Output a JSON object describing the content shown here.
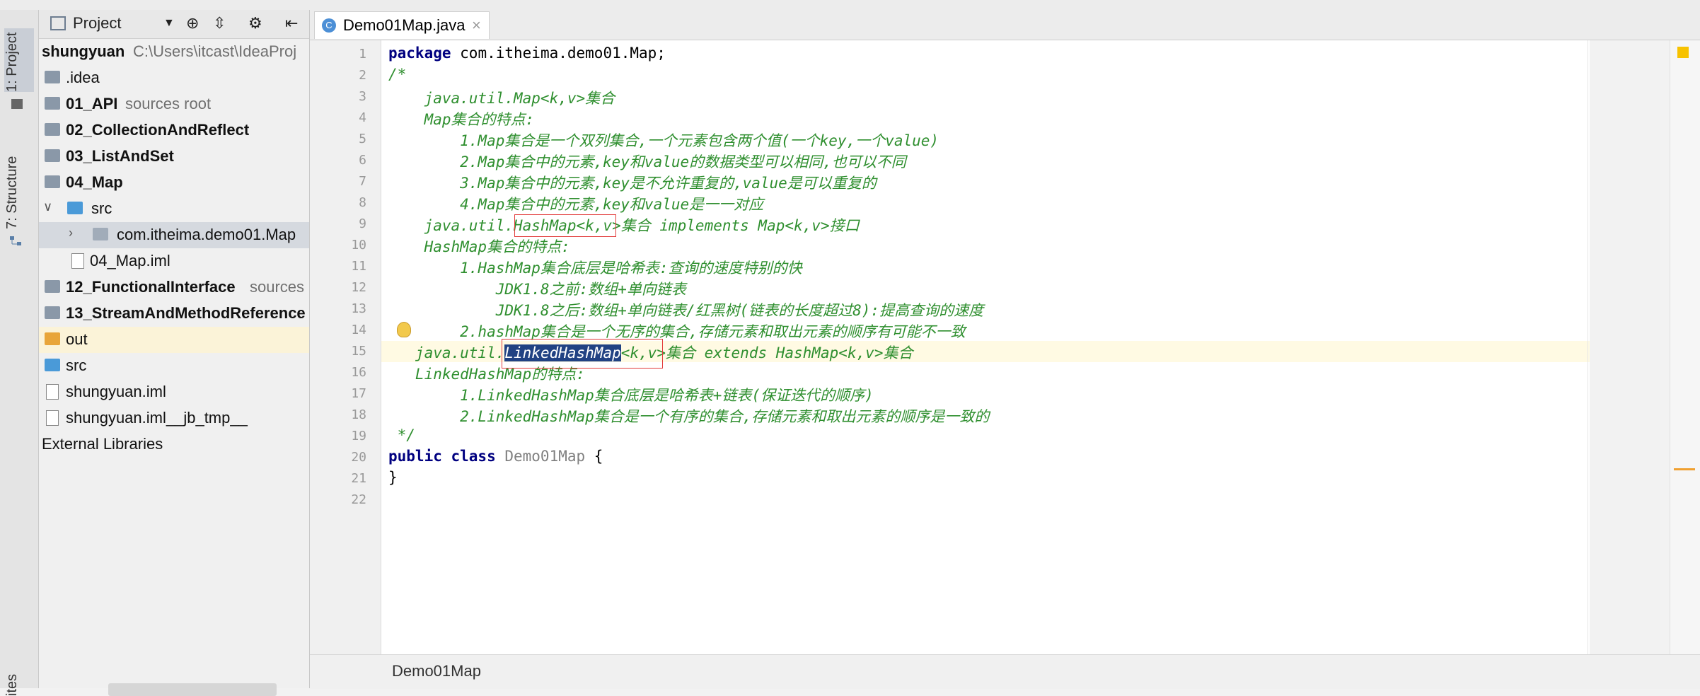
{
  "left_strip": {
    "project_tab": "1: Project",
    "structure_tab": "7: Structure",
    "bottom_tab": "ites"
  },
  "project_panel": {
    "title": "Project",
    "tree": [
      {
        "label": "shungyuan",
        "hint": "C:\\Users\\itcast\\IdeaProj"
      },
      {
        "label": ".idea",
        "hint": ""
      },
      {
        "label": "01_API",
        "hint": "sources root"
      },
      {
        "label": "02_CollectionAndReflect",
        "hint": ""
      },
      {
        "label": "03_ListAndSet",
        "hint": ""
      },
      {
        "label": "04_Map",
        "hint": ""
      },
      {
        "label": "src",
        "hint": ""
      },
      {
        "label": "com.itheima.demo01.Map",
        "hint": ""
      },
      {
        "label": "04_Map.iml",
        "hint": ""
      },
      {
        "label": "12_FunctionalInterface",
        "hint": "sources"
      },
      {
        "label": "13_StreamAndMethodReference",
        "hint": ""
      },
      {
        "label": "out",
        "hint": ""
      },
      {
        "label": "src",
        "hint": ""
      },
      {
        "label": "shungyuan.iml",
        "hint": ""
      },
      {
        "label": "shungyuan.iml__jb_tmp__",
        "hint": ""
      },
      {
        "label": "External Libraries",
        "hint": ""
      }
    ]
  },
  "editor": {
    "tab_label": "Demo01Map.java",
    "line_numbers": [
      "1",
      "2",
      "3",
      "4",
      "5",
      "6",
      "7",
      "8",
      "9",
      "10",
      "11",
      "12",
      "13",
      "14",
      "15",
      "16",
      "17",
      "18",
      "19",
      "20",
      "21",
      "22"
    ],
    "code": {
      "l1_kw": "package",
      "l1_rest": " com.itheima.demo01.Map;",
      "l2": "/*",
      "l3": "    java.util.Map<k,v>集合",
      "l4": "    Map集合的特点:",
      "l5": "        1.Map集合是一个双列集合,一个元素包含两个值(一个key,一个value)",
      "l6": "        2.Map集合中的元素,key和value的数据类型可以相同,也可以不同",
      "l7": "        3.Map集合中的元素,key是不允许重复的,value是可以重复的",
      "l8": "        4.Map集合中的元素,key和value是一一对应",
      "l9": "    java.util.HashMap<k,v>集合 implements Map<k,v>接口",
      "l10": "    HashMap集合的特点:",
      "l11": "        1.HashMap集合底层是哈希表:查询的速度特别的快",
      "l12": "            JDK1.8之前:数组+单向链表",
      "l13": "            JDK1.8之后:数组+单向链表/红黑树(链表的长度超过8):提高查询的速度",
      "l14": "        2.hashMap集合是一个无序的集合,存储元素和取出元素的顺序有可能不一致",
      "l15_pre": "   java.util.",
      "l15_sel": "LinkedHashMap",
      "l15_post": "<k,v>集合 extends HashMap<k,v>集合",
      "l16": "   LinkedHashMap的特点:",
      "l17": "        1.LinkedHashMap集合底层是哈希表+链表(保证迭代的顺序)",
      "l18": "        2.LinkedHashMap集合是一个有序的集合,存储元素和取出元素的顺序是一致的",
      "l19": " */",
      "l20_kw": "public class",
      "l20_name": " Demo01Map",
      "l20_rest": " {",
      "l21": "}"
    },
    "breadcrumb": "Demo01Map"
  },
  "colors": {
    "keyword": "#000080",
    "comment": "#2f8f2f",
    "selection": "#214283",
    "annotation_box": "#e23b3b"
  }
}
